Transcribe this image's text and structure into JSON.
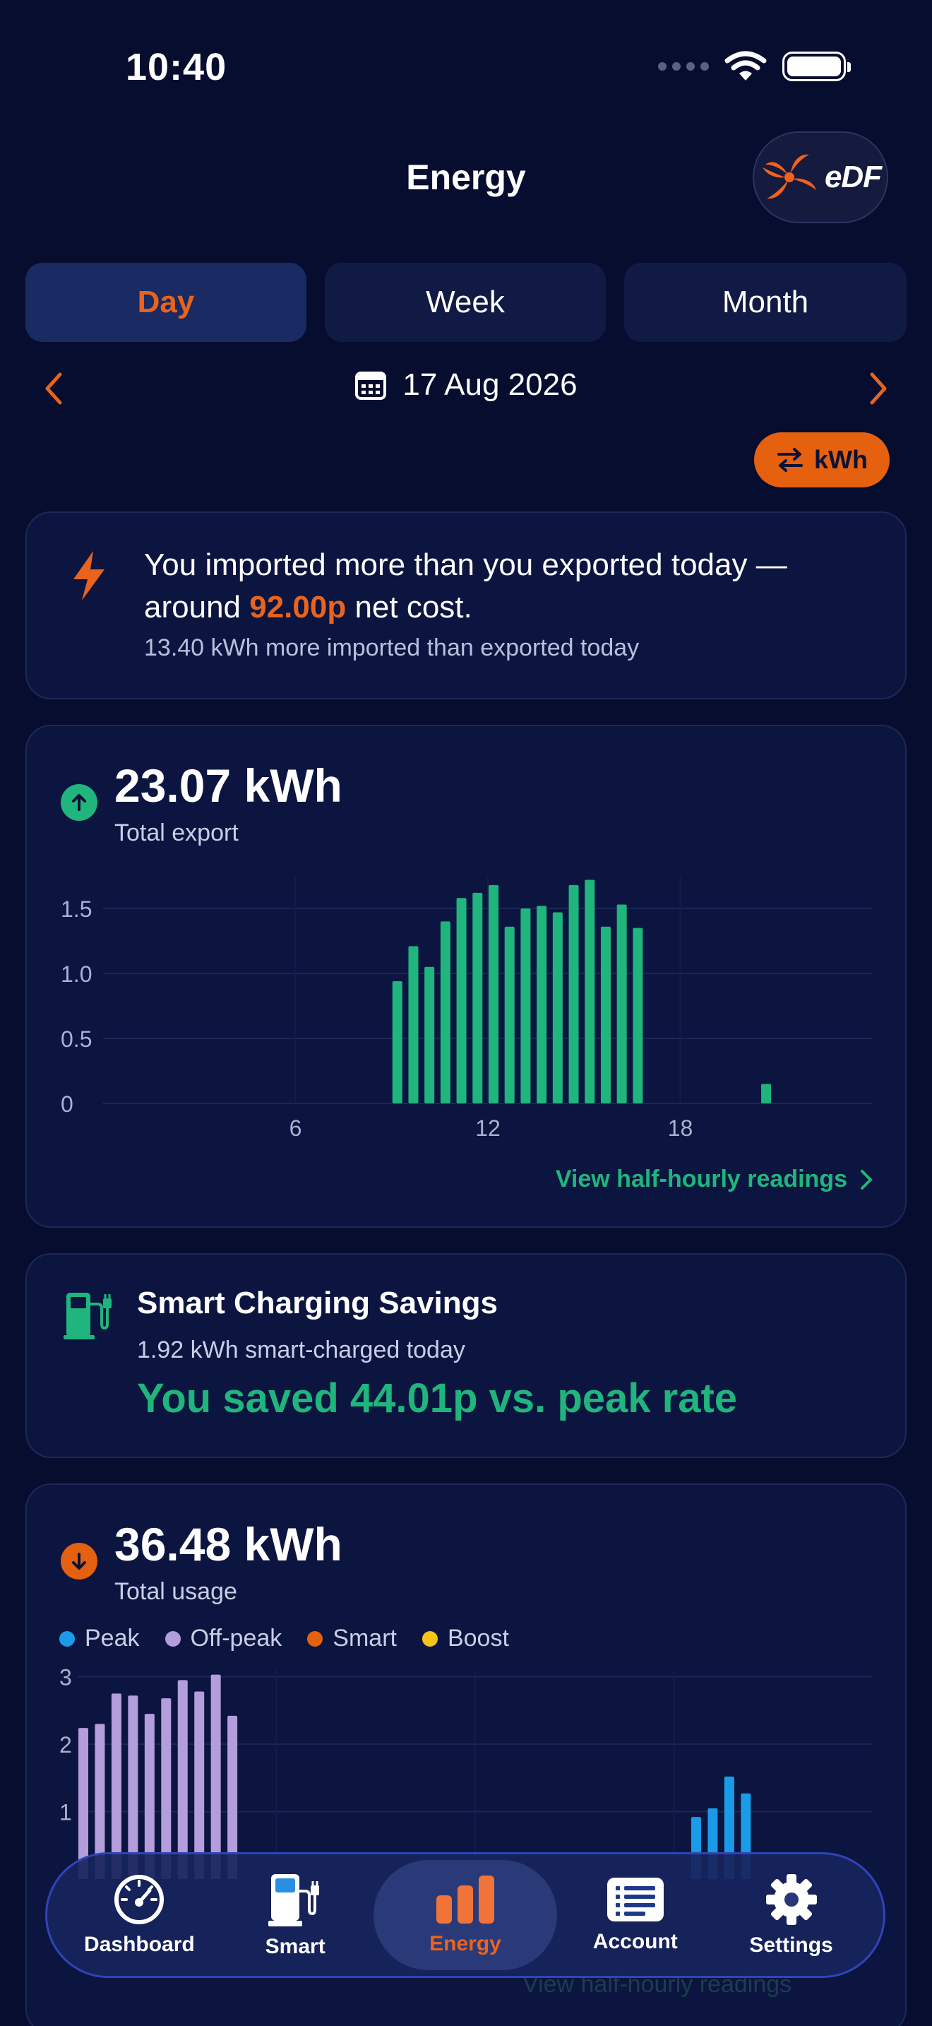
{
  "status_bar": {
    "time": "10:40"
  },
  "header": {
    "title": "Energy",
    "logo_text": "eDF"
  },
  "period_tabs": [
    {
      "label": "Day",
      "active": true
    },
    {
      "label": "Week",
      "active": false
    },
    {
      "label": "Month",
      "active": false
    }
  ],
  "date_nav": {
    "date": "17 Aug 2026"
  },
  "unit_toggle": {
    "label": "kWh"
  },
  "net_summary": {
    "line_before": "You imported more than you exported today — around ",
    "amount": "92.00p",
    "line_after": " net cost.",
    "detail": "13.40 kWh more imported than exported today"
  },
  "export_card": {
    "total": "23.07 kWh",
    "label": "Total export",
    "link": "View half-hourly readings"
  },
  "savings_card": {
    "title": "Smart Charging Savings",
    "subtitle": "1.92 kWh smart-charged today",
    "headline": "You saved 44.01p vs. peak rate"
  },
  "usage_card": {
    "total": "36.48 kWh",
    "label": "Total usage",
    "legend": [
      {
        "name": "Peak",
        "color": "#1a9be8"
      },
      {
        "name": "Off-peak",
        "color": "#b39ddb"
      },
      {
        "name": "Smart",
        "color": "#e5600f"
      },
      {
        "name": "Boost",
        "color": "#f5c518"
      }
    ],
    "link": "View half-hourly readings"
  },
  "chart_data": [
    {
      "type": "bar",
      "series": [
        {
          "name": "Export",
          "x": [
            9,
            9.5,
            10,
            10.5,
            11,
            11.5,
            12,
            12.5,
            13,
            13.5,
            14,
            14.5,
            15,
            15.5,
            16,
            16.5,
            20.5
          ],
          "values": [
            0.94,
            1.21,
            1.05,
            1.4,
            1.58,
            1.62,
            1.68,
            1.36,
            1.5,
            1.52,
            1.47,
            1.68,
            1.72,
            1.36,
            1.53,
            1.35,
            0.15
          ]
        }
      ],
      "x_ticks": [
        "6",
        "12",
        "18"
      ],
      "y_ticks": [
        "0",
        "0.5",
        "1.0",
        "1.5"
      ],
      "xlim": [
        0,
        24
      ],
      "ylim": [
        0,
        1.75
      ],
      "grid": true
    },
    {
      "type": "bar",
      "series": [
        {
          "name": "Off-peak",
          "x": [
            0,
            0.5,
            1,
            1.5,
            2,
            2.5,
            3,
            3.5,
            4,
            4.5
          ],
          "values": [
            2.24,
            2.3,
            2.75,
            2.72,
            2.45,
            2.68,
            2.95,
            2.78,
            3.03,
            2.42
          ]
        },
        {
          "name": "Peak",
          "x": [
            18.5,
            19,
            19.5,
            20
          ],
          "values": [
            0.92,
            1.05,
            1.52,
            1.27
          ]
        }
      ],
      "y_ticks": [
        "1",
        "2",
        "3"
      ],
      "xlim": [
        0,
        24
      ],
      "ylim": [
        0,
        3.1
      ],
      "grid": true
    }
  ],
  "tab_bar": [
    {
      "label": "Dashboard",
      "icon": "speedometer-icon",
      "active": false
    },
    {
      "label": "Smart",
      "icon": "ev-charger-icon",
      "active": false
    },
    {
      "label": "Energy",
      "icon": "bar-chart-icon",
      "active": true
    },
    {
      "label": "Account",
      "icon": "document-list-icon",
      "active": false
    },
    {
      "label": "Settings",
      "icon": "gear-icon",
      "active": false
    }
  ]
}
